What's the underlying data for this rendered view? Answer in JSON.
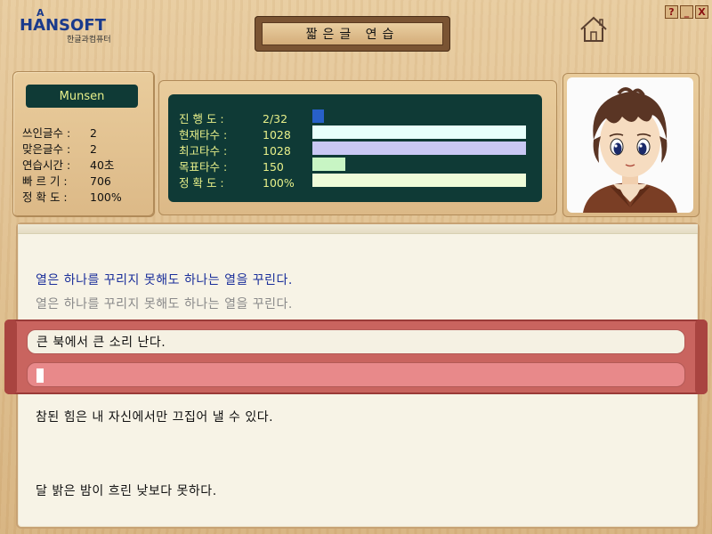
{
  "app": {
    "logo_text": "HANSOFT",
    "logo_sub": "한글과컴퓨터",
    "title": "짧은글 연습"
  },
  "window_buttons": {
    "help": "?",
    "minimize": "_",
    "close": "X"
  },
  "user": {
    "name": "Munsen"
  },
  "stats": [
    {
      "label": "쓰인글수 :",
      "value": "2"
    },
    {
      "label": "맞은글수 :",
      "value": "2"
    },
    {
      "label": "연습시간 :",
      "value": "40초"
    },
    {
      "label": "빠 르 기 :",
      "value": "706"
    },
    {
      "label": "정 확 도 :",
      "value": "100%"
    }
  ],
  "progress": [
    {
      "label": "진 행 도 :",
      "value": "2/32",
      "fill": 0.055,
      "color": "#2860c8"
    },
    {
      "label": "현재타수 :",
      "value": "1028",
      "fill": 1.0,
      "color": "#e8fffc"
    },
    {
      "label": "최고타수 :",
      "value": "1028",
      "fill": 1.0,
      "color": "#c9c8f4"
    },
    {
      "label": "목표타수 :",
      "value": "150",
      "fill": 0.155,
      "color": "#c8f5c4"
    },
    {
      "label": "정 확 도 :",
      "value": "100%",
      "fill": 1.0,
      "color": "#eefbd9"
    }
  ],
  "lines": {
    "previous_target": "열은 하나를 꾸리지 못해도 하나는 열을 꾸린다.",
    "previous_typed": "열은 하나를 꾸리지 못해도 하나는 열을 꾸린다.",
    "current_target": "큰 북에서 큰 소리 난다.",
    "next_1": "참된 힘은 내 자신에서만 끄집어 낼 수 있다.",
    "next_2": "달 밝은 밤이 흐린 낮보다 못하다."
  },
  "colors": {
    "previous_target": "#1a2e9a",
    "previous_typed": "#8a8a8a",
    "band": "#c9645f",
    "panel_dark": "#0f3a36",
    "panel_text": "#e8f08a"
  }
}
